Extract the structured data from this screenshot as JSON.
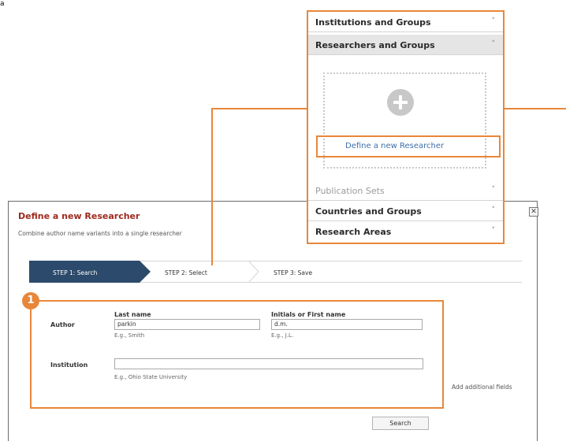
{
  "corner_mark": "a",
  "dialog": {
    "title": "Define a new Researcher",
    "subtitle": "Combine author name variants into a single researcher",
    "close_icon": "close-icon"
  },
  "steps": [
    {
      "label": "STEP 1: Search",
      "active": true
    },
    {
      "label": "STEP 2: Select",
      "active": false
    },
    {
      "label": "STEP 3: Save",
      "active": false
    }
  ],
  "form": {
    "badge": "1",
    "author_label": "Author",
    "last_name_header": "Last name",
    "last_name_value": "parkin",
    "last_name_hint": "E.g., Smith",
    "initials_header": "Initials or First name",
    "initials_value": "d.m.",
    "initials_hint": "E.g., J.L.",
    "institution_label": "Institution",
    "institution_value": "",
    "institution_hint": "E.g., Ohio State University",
    "add_fields_link": "Add additional fields",
    "search_button": "Search"
  },
  "panel": {
    "rows": [
      {
        "label": "Institutions and Groups",
        "chevron": "˅",
        "state": "collapsed"
      },
      {
        "label": "Researchers and Groups",
        "chevron": "˄",
        "state": "expanded"
      }
    ],
    "define_link": "Define a new Researcher",
    "rows_after": [
      {
        "label": "Publication Sets",
        "chevron": "˅",
        "state": "disabled"
      },
      {
        "label": "Countries and Groups",
        "chevron": "˅",
        "state": "collapsed"
      },
      {
        "label": "Research Areas",
        "chevron": "˅",
        "state": "collapsed"
      }
    ]
  },
  "colors": {
    "accent_orange": "#e8873a",
    "title_red": "#9e2a1e",
    "step_active": "#2c4a6b",
    "link_blue": "#3f6fa8"
  }
}
